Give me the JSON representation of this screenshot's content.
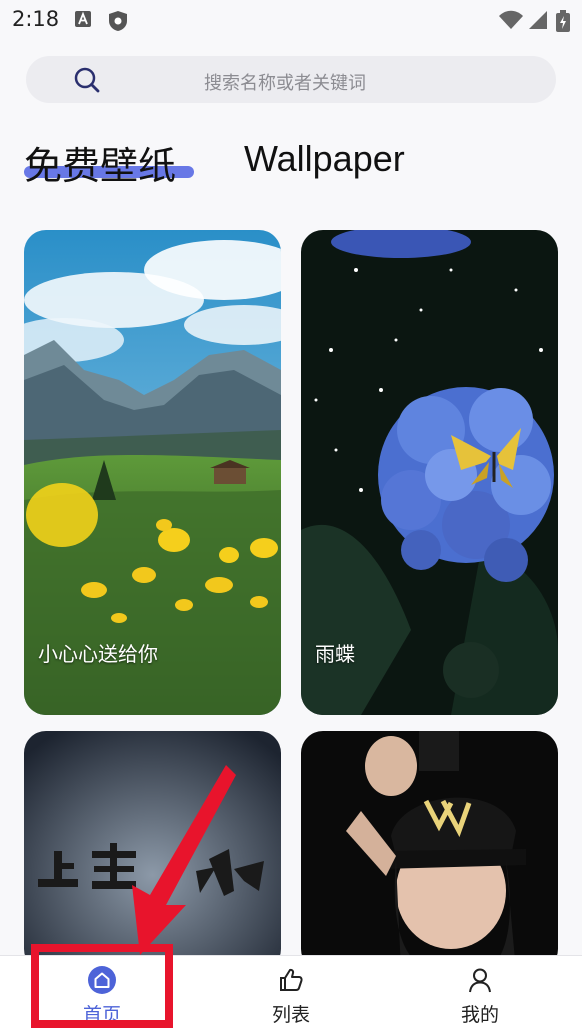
{
  "status_bar": {
    "time": "2:18",
    "icons": [
      "a-icon",
      "shield-icon",
      "wifi-icon",
      "signal-icon",
      "battery-icon"
    ]
  },
  "search": {
    "placeholder": "搜索名称或者关键词",
    "icon": "search-icon"
  },
  "header": {
    "title_cn": "免费壁纸",
    "title_en": "Wallpaper",
    "accent_color": "#6878e6"
  },
  "wallpapers": [
    {
      "caption": "小心心送给你"
    },
    {
      "caption": "雨蝶"
    },
    {
      "caption": ""
    },
    {
      "caption": ""
    }
  ],
  "bottom_nav": {
    "active_color": "#4d63d8",
    "items": [
      {
        "label": "首页",
        "icon": "home-icon",
        "active": true
      },
      {
        "label": "列表",
        "icon": "thumbs-up-icon",
        "active": false
      },
      {
        "label": "我的",
        "icon": "person-icon",
        "active": false
      }
    ]
  },
  "annotation": {
    "color": "#e8142c",
    "type": "red-box-and-arrow"
  }
}
